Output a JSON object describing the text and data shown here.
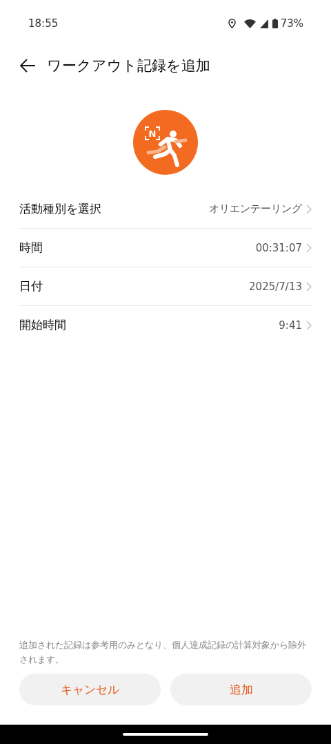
{
  "status_bar": {
    "time": "18:55",
    "battery": "73%"
  },
  "header": {
    "title": "ワークアウト記録を追加"
  },
  "activity_icon": {
    "badge": "N"
  },
  "rows": [
    {
      "label": "活動種別を選択",
      "value": "オリエンテーリング"
    },
    {
      "label": "時間",
      "value": "00:31:07"
    },
    {
      "label": "日付",
      "value": "2025/7/13"
    },
    {
      "label": "開始時間",
      "value": "9:41"
    }
  ],
  "note": "追加された記録は参考用のみとなり、個人達成記録の計算対象から除外されます。",
  "buttons": [
    {
      "label": "キャンセル"
    },
    {
      "label": "追加"
    }
  ]
}
